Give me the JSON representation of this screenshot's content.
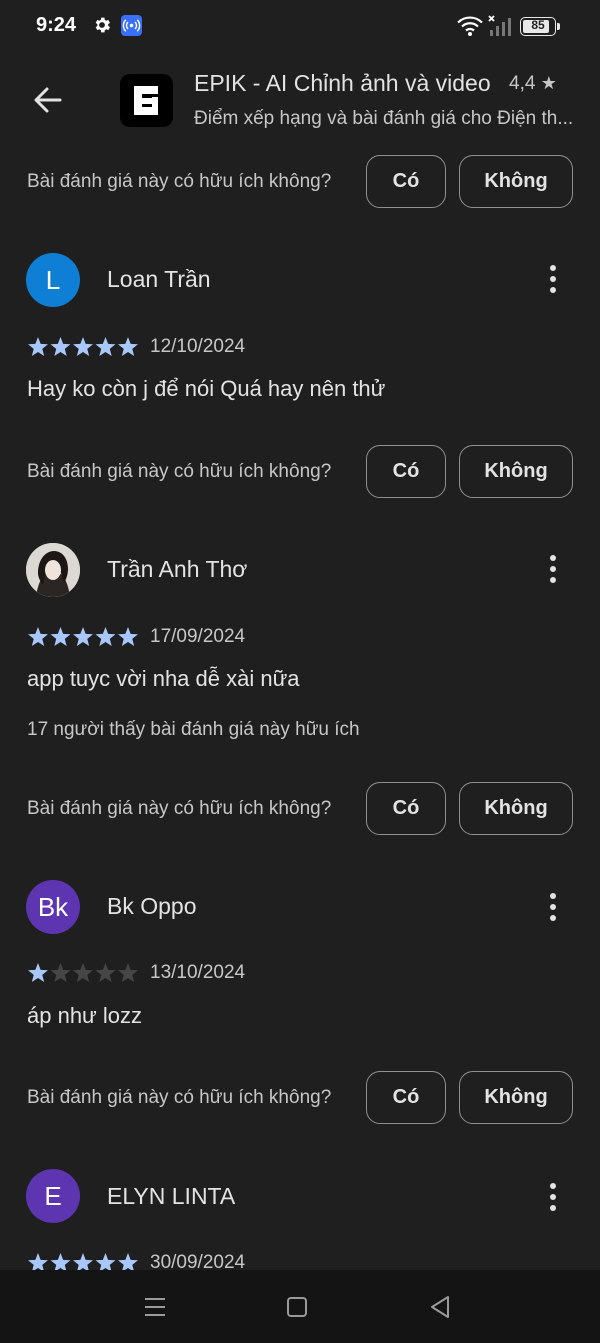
{
  "status_bar": {
    "time": "9:24",
    "battery": "85",
    "battery_level": 0.85
  },
  "header": {
    "app_title": "EPIK - AI Chỉnh ảnh và video",
    "rating": "4,4",
    "subtitle": "Điểm xếp hạng và bài đánh giá cho Điện th..."
  },
  "helpful_prompt": {
    "question": "Bài đánh giá này có hữu ích không?",
    "yes": "Có",
    "no": "Không"
  },
  "reviews": [
    {
      "name": "Loan Trần",
      "avatar_letter": "L",
      "avatar_color": "#0f7fd6",
      "rating": 5,
      "date": "12/10/2024",
      "text": "Hay ko còn j để nói Quá hay nên thử",
      "helpful_count_text": ""
    },
    {
      "name": "Trần Anh Thơ",
      "avatar_letter": "",
      "avatar_color": "#d9d6d3",
      "rating": 5,
      "date": "17/09/2024",
      "text": "app tuyc vời nha dễ xài nữa",
      "helpful_count_text": "17 người thấy bài đánh giá này hữu ích"
    },
    {
      "name": "Bk Oppo",
      "avatar_letter": "Bk",
      "avatar_color": "#5e35b1",
      "rating": 1,
      "date": "13/10/2024",
      "text": "áp như lozz",
      "helpful_count_text": ""
    },
    {
      "name": "ELYN LINTA",
      "avatar_letter": "E",
      "avatar_color": "#5e35b1",
      "rating": 5,
      "date": "30/09/2024",
      "text": "",
      "helpful_count_text": ""
    }
  ],
  "colors": {
    "background": "#1f1f1f",
    "star_filled": "#a8c7fa",
    "star_empty": "#444746",
    "navbar": "#141414"
  },
  "icons": [
    "gear-icon",
    "hotspot-icon",
    "wifi-icon",
    "signal-icon",
    "battery-icon",
    "back-arrow-icon",
    "more-vert-icon",
    "star-icon",
    "menu-icon",
    "home-icon",
    "back-icon"
  ]
}
